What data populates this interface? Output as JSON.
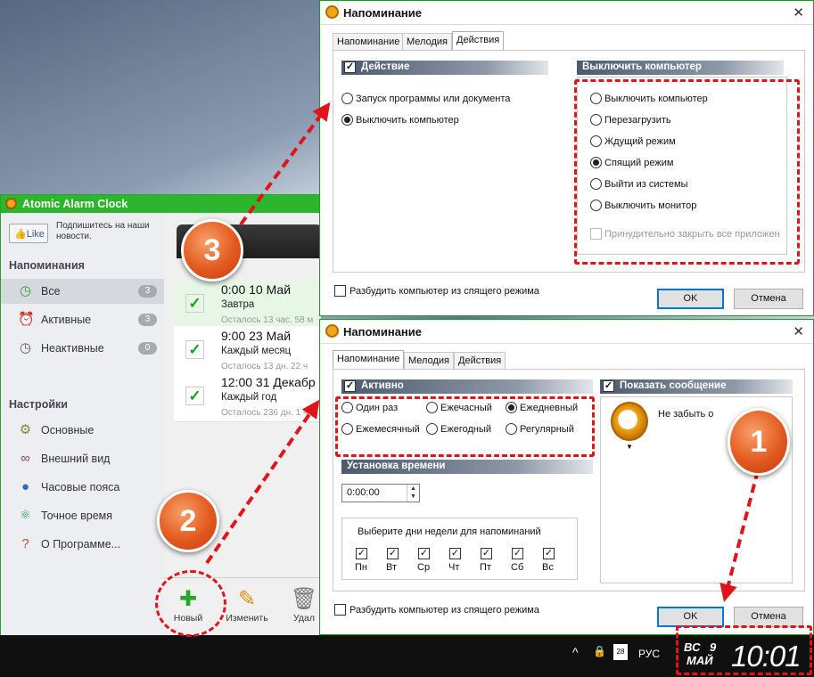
{
  "taskbar": {
    "caret": "^",
    "lang": "РУС",
    "day_of_week": "ВС",
    "day": "9",
    "month": "МАЙ",
    "time": "10:01",
    "battery": "28"
  },
  "app": {
    "title": "Atomic Alarm Clock",
    "like_label": "Like",
    "subscribe_text": "Подпишитесь на наши новости.",
    "reminders_header": "Напоминания",
    "reminder_filters": [
      {
        "label": "Все",
        "count": "3"
      },
      {
        "label": "Активные",
        "count": "3"
      },
      {
        "label": "Неактивные",
        "count": "0"
      }
    ],
    "settings_header": "Настройки",
    "settings_items": [
      "Основные",
      "Внешний вид",
      "Часовые пояса",
      "Точное время",
      "О Программе..."
    ],
    "alarms": [
      {
        "time": "0:00  10 Май",
        "repeat": "Завтра",
        "remaining": "Осталось 13 час. 58 м"
      },
      {
        "time": "9:00  23 Май",
        "repeat": "Каждый месяц",
        "remaining": "Осталось 13 дн. 22 ч"
      },
      {
        "time": "12:00  31 Декабр",
        "repeat": "Каждый год",
        "remaining": "Осталось 236 дн. 1 ч"
      }
    ],
    "toolbar": {
      "new": "Новый",
      "edit": "Изменить",
      "delete": "Удал"
    }
  },
  "dialog_actions": {
    "title": "Напоминание",
    "tabs": [
      "Напоминание",
      "Мелодия",
      "Действия"
    ],
    "action_header": "Действие",
    "action_options": [
      "Запуск программы или документа",
      "Выключить компьютер"
    ],
    "shutdown_header": "Выключить компьютер",
    "shutdown_options": [
      "Выключить компьютер",
      "Перезагрузить",
      "Ждущий режим",
      "Спящий режим",
      "Выйти из системы",
      "Выключить монитор"
    ],
    "force_close": "Принудительно закрыть все приложен",
    "wake_label": "Разбудить компьютер из спящего режима",
    "ok": "OK",
    "cancel": "Отмена"
  },
  "dialog_reminder": {
    "title": "Напоминание",
    "tabs": [
      "Напоминание",
      "Мелодия",
      "Действия"
    ],
    "active_header": "Активно",
    "repeat_options": [
      "Один раз",
      "Ежечасный",
      "Ежедневный",
      "Ежемесячный",
      "Ежегодный",
      "Регулярный"
    ],
    "time_header": "Установка времени",
    "time_value": "0:00:00",
    "weekdays_title": "Выберите дни недели для напоминаний",
    "weekdays": [
      "Пн",
      "Вт",
      "Ср",
      "Чт",
      "Пт",
      "Сб",
      "Вс"
    ],
    "show_message_header": "Показать сообщение",
    "message_text": "Не забыть о",
    "wake_label": "Разбудить компьютер из спящего режима",
    "ok": "OK",
    "cancel": "Отмена"
  },
  "callouts": [
    "1",
    "2",
    "3"
  ],
  "colors": {
    "accent_green": "#2db52d",
    "annotation_red": "#e0141b",
    "callout_orange": "#e35a1f",
    "default_button": "#0078d7"
  }
}
